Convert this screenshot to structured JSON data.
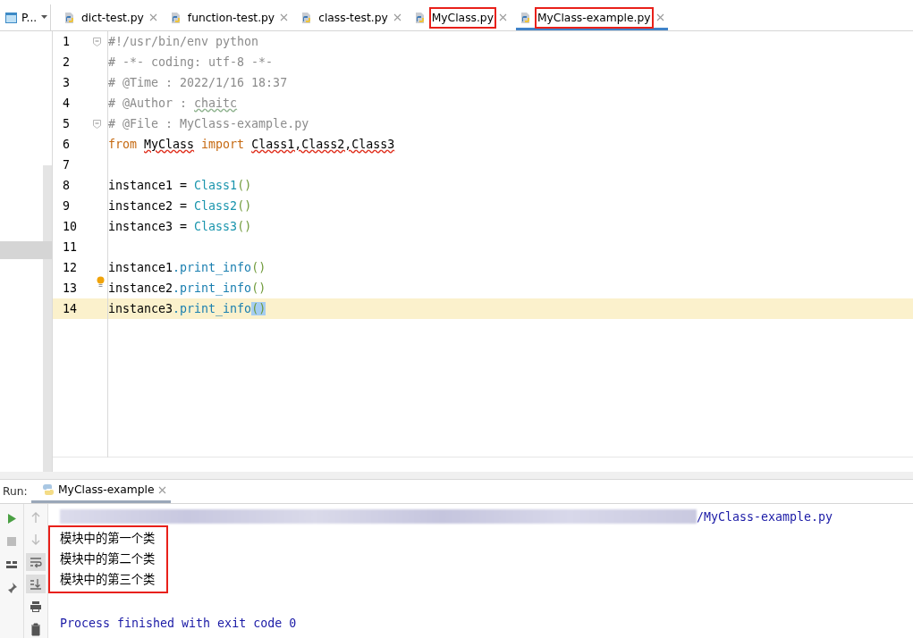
{
  "project_tab": {
    "label": "P..."
  },
  "tabs": [
    {
      "label": "dict-test.py",
      "selected": false,
      "highlighted": false
    },
    {
      "label": "function-test.py",
      "selected": false,
      "highlighted": false
    },
    {
      "label": "class-test.py",
      "selected": false,
      "highlighted": false
    },
    {
      "label": "MyClass.py",
      "selected": false,
      "highlighted": true
    },
    {
      "label": "MyClass-example.py",
      "selected": true,
      "highlighted": true
    }
  ],
  "editor": {
    "lines": [
      {
        "number": "1",
        "fold": true,
        "current": false,
        "bulb": false,
        "tokens": [
          {
            "text": "#!/usr/bin/env python",
            "kind": "comment"
          }
        ]
      },
      {
        "number": "2",
        "fold": false,
        "current": false,
        "bulb": false,
        "tokens": [
          {
            "text": "# -*- coding: utf-8 -*-",
            "kind": "comment"
          }
        ]
      },
      {
        "number": "3",
        "fold": false,
        "current": false,
        "bulb": false,
        "tokens": [
          {
            "text": "# @Time : 2022/1/16 18:37",
            "kind": "comment"
          }
        ]
      },
      {
        "number": "4",
        "fold": false,
        "current": false,
        "bulb": false,
        "tokens": [
          {
            "text": "# @Author : ",
            "kind": "comment"
          },
          {
            "text": "chaitc",
            "kind": "comment-typo"
          }
        ]
      },
      {
        "number": "5",
        "fold": true,
        "current": false,
        "bulb": false,
        "tokens": [
          {
            "text": "# @File : MyClass-example.py",
            "kind": "comment"
          }
        ]
      },
      {
        "number": "6",
        "fold": false,
        "current": false,
        "bulb": false,
        "tokens": [
          {
            "text": "from ",
            "kind": "keyword"
          },
          {
            "text": "MyClass",
            "kind": "error"
          },
          {
            "text": " import ",
            "kind": "keyword"
          },
          {
            "text": "Class1,Class2,Class3",
            "kind": "error"
          }
        ]
      },
      {
        "number": "7",
        "fold": false,
        "current": false,
        "bulb": false
      },
      {
        "number": "8",
        "fold": false,
        "current": false,
        "bulb": false,
        "tokens": [
          {
            "text": "instance1 = ",
            "kind": "text"
          },
          {
            "text": "Class1",
            "kind": "call"
          },
          {
            "text": "()",
            "kind": "paren"
          }
        ]
      },
      {
        "number": "9",
        "fold": false,
        "current": false,
        "bulb": false,
        "tokens": [
          {
            "text": "instance2 = ",
            "kind": "text"
          },
          {
            "text": "Class2",
            "kind": "call"
          },
          {
            "text": "()",
            "kind": "paren"
          }
        ]
      },
      {
        "number": "10",
        "fold": false,
        "current": false,
        "bulb": false,
        "tokens": [
          {
            "text": "instance3 = ",
            "kind": "text"
          },
          {
            "text": "Class3",
            "kind": "call"
          },
          {
            "text": "()",
            "kind": "paren"
          }
        ]
      },
      {
        "number": "11",
        "fold": false,
        "current": false,
        "bulb": false
      },
      {
        "number": "12",
        "fold": false,
        "current": false,
        "bulb": false,
        "tokens": [
          {
            "text": "instance1",
            "kind": "text"
          },
          {
            "text": ".print_info",
            "kind": "method"
          },
          {
            "text": "()",
            "kind": "paren"
          }
        ]
      },
      {
        "number": "13",
        "fold": false,
        "current": false,
        "bulb": true,
        "tokens": [
          {
            "text": "instance2",
            "kind": "text"
          },
          {
            "text": ".print_info",
            "kind": "method"
          },
          {
            "text": "()",
            "kind": "paren"
          }
        ]
      },
      {
        "number": "14",
        "fold": false,
        "current": true,
        "bulb": false,
        "tokens": [
          {
            "text": "instance3",
            "kind": "text"
          },
          {
            "text": ".print_info",
            "kind": "method"
          },
          {
            "text": "()",
            "kind": "paren-match"
          }
        ]
      }
    ]
  },
  "run": {
    "label": "Run:",
    "tab": {
      "label": "MyClass-example",
      "selected": true
    },
    "tools_main": [
      {
        "kind": "run",
        "on": false
      },
      {
        "kind": "stop",
        "on": false
      },
      {
        "kind": "layout",
        "on": false
      },
      {
        "kind": "pin",
        "on": false
      }
    ],
    "tools_side": [
      {
        "kind": "up",
        "on": false
      },
      {
        "kind": "down",
        "on": false
      },
      {
        "kind": "wrap",
        "on": true
      },
      {
        "kind": "scroll-end",
        "on": true
      },
      {
        "kind": "print",
        "on": false
      },
      {
        "kind": "trash",
        "on": false
      }
    ],
    "command_tail": "/MyClass-example.py",
    "output": {
      "highlighted": true,
      "lines": [
        "模块中的第一个类",
        "模块中的第二个类",
        "模块中的第三个类"
      ]
    },
    "exit_message": "Process finished with exit code 0"
  }
}
